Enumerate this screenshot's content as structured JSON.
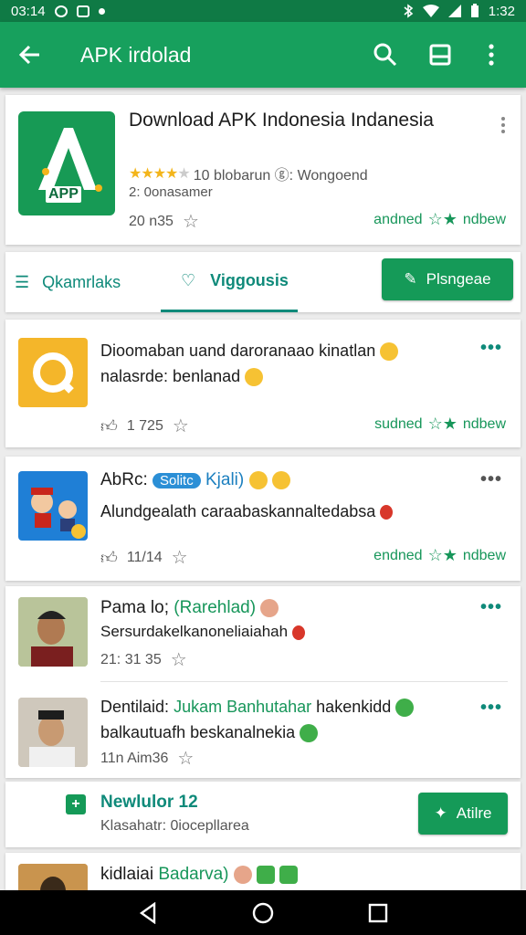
{
  "status_bar": {
    "time_left": "03:14",
    "time_right": "1:32"
  },
  "app_bar": {
    "title": "APK irdolad"
  },
  "app_header": {
    "title": "Download APK Indonesia Indanesia",
    "icon_label": "APP",
    "rating_text": "10 blobarun ⓖ: Wongoend",
    "subtitle": "2: 0onasamer",
    "meta": "20 n35",
    "action": "andned"
  },
  "tabs": {
    "tab1": "Qkamrlaks",
    "tab2": "Viggousis",
    "button": "Plsngeae"
  },
  "posts": [
    {
      "text1": "Dioomaban uand daroranaao kinatlan",
      "text2": "nalasrde: benlanad",
      "meta": "1 725",
      "action": "sudned"
    },
    {
      "name": "AbRc:",
      "badge": "Solitc",
      "extra": "Kjali)",
      "text": "Alundgealath caraabaskannaltedabsa",
      "meta": "11/14",
      "action": "endned"
    },
    {
      "name": "Pama lo;",
      "extra": "(Rarehlad)",
      "text": "Sersurdakelkanoneliaiahah",
      "meta": "21: 31 35"
    },
    {
      "name": "Dentilaid:",
      "extra": "Jukam Banhutahar",
      "text1": "hakenkidd",
      "text2": "balkautuafh beskanalnekia",
      "meta": "11n Aim36"
    }
  ],
  "new_section": {
    "title": "Newlulor 12",
    "subtitle": "Klasahatr: 0iocepllarea",
    "button": "Atilre"
  },
  "last_row": {
    "name": "kidlaiai",
    "extra": "Badarva)"
  },
  "action_suffix": "ndbew",
  "colors": {
    "primary": "#17a05d",
    "status": "#0f7a45",
    "accent_teal": "#0f8a7a",
    "star": "#f3b51b"
  }
}
